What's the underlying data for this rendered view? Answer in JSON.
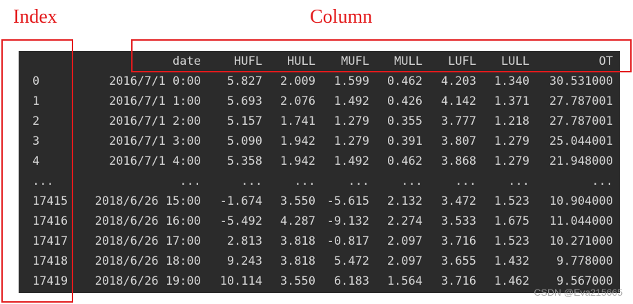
{
  "annotations": {
    "index_label": "Index",
    "column_label": "Column",
    "color": "#e31a1c"
  },
  "dataframe": {
    "header": [
      "",
      "date",
      "HUFL",
      "HULL",
      "MUFL",
      "MULL",
      "LUFL",
      "LULL",
      "OT"
    ],
    "rows": [
      [
        "0",
        "2016/7/1 0:00",
        "5.827",
        "2.009",
        "1.599",
        "0.462",
        "4.203",
        "1.340",
        "30.531000"
      ],
      [
        "1",
        "2016/7/1 1:00",
        "5.693",
        "2.076",
        "1.492",
        "0.426",
        "4.142",
        "1.371",
        "27.787001"
      ],
      [
        "2",
        "2016/7/1 2:00",
        "5.157",
        "1.741",
        "1.279",
        "0.355",
        "3.777",
        "1.218",
        "27.787001"
      ],
      [
        "3",
        "2016/7/1 3:00",
        "5.090",
        "1.942",
        "1.279",
        "0.391",
        "3.807",
        "1.279",
        "25.044001"
      ],
      [
        "4",
        "2016/7/1 4:00",
        "5.358",
        "1.942",
        "1.492",
        "0.462",
        "3.868",
        "1.279",
        "21.948000"
      ],
      [
        "...",
        "...",
        "...",
        "...",
        "...",
        "...",
        "...",
        "...",
        "..."
      ],
      [
        "17415",
        "2018/6/26 15:00",
        "-1.674",
        "3.550",
        "-5.615",
        "2.132",
        "3.472",
        "1.523",
        "10.904000"
      ],
      [
        "17416",
        "2018/6/26 16:00",
        "-5.492",
        "4.287",
        "-9.132",
        "2.274",
        "3.533",
        "1.675",
        "11.044000"
      ],
      [
        "17417",
        "2018/6/26 17:00",
        "2.813",
        "3.818",
        "-0.817",
        "2.097",
        "3.716",
        "1.523",
        "10.271000"
      ],
      [
        "17418",
        "2018/6/26 18:00",
        "9.243",
        "3.818",
        "5.472",
        "2.097",
        "3.655",
        "1.432",
        "9.778000"
      ],
      [
        "17419",
        "2018/6/26 19:00",
        "10.114",
        "3.550",
        "6.183",
        "1.564",
        "3.716",
        "1.462",
        "9.567000"
      ]
    ],
    "background": "#2b2b2b",
    "text_color": "#d4d4d4"
  },
  "watermark": "CSDN @Eva215665"
}
